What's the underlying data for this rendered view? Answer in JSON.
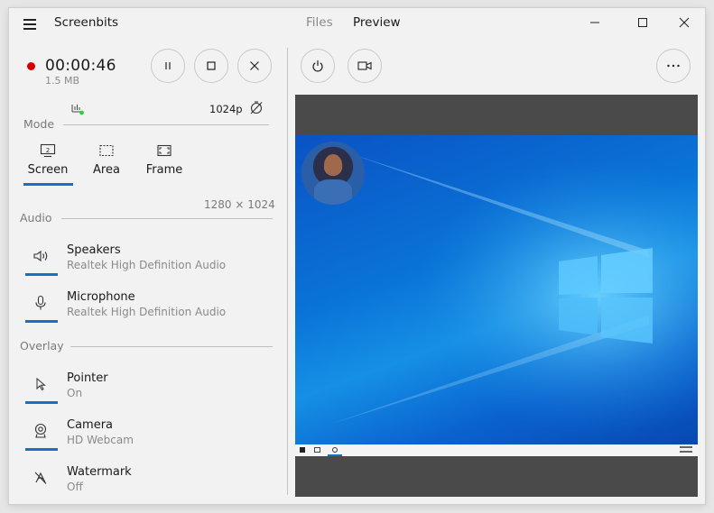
{
  "app": {
    "title": "Screenbits"
  },
  "tabs": [
    {
      "label": "Files"
    },
    {
      "label": "Preview"
    }
  ],
  "recording": {
    "time": "00:00:46",
    "size": "1.5 MB"
  },
  "stats": {
    "resolution_label": "1024p"
  },
  "mode": {
    "label": "Mode",
    "options": [
      {
        "label": "Screen"
      },
      {
        "label": "Area"
      },
      {
        "label": "Frame"
      }
    ],
    "selected": "Screen",
    "dimensions": "1280 × 1024"
  },
  "audio": {
    "label": "Audio",
    "items": [
      {
        "title": "Speakers",
        "subtitle": "Realtek High Definition Audio",
        "icon": "speaker-icon"
      },
      {
        "title": "Microphone",
        "subtitle": "Realtek High Definition Audio",
        "icon": "microphone-icon"
      }
    ]
  },
  "overlay": {
    "label": "Overlay",
    "items": [
      {
        "title": "Pointer",
        "subtitle": "On",
        "icon": "pointer-icon"
      },
      {
        "title": "Camera",
        "subtitle": "HD Webcam",
        "icon": "webcam-icon"
      },
      {
        "title": "Watermark",
        "subtitle": "Off",
        "icon": "watermark-off-icon"
      }
    ]
  },
  "colors": {
    "accent": "#1a6fc0",
    "record": "#d40000",
    "window_bg": "#f2f2f2",
    "preview_bg": "#4a4a4a"
  }
}
